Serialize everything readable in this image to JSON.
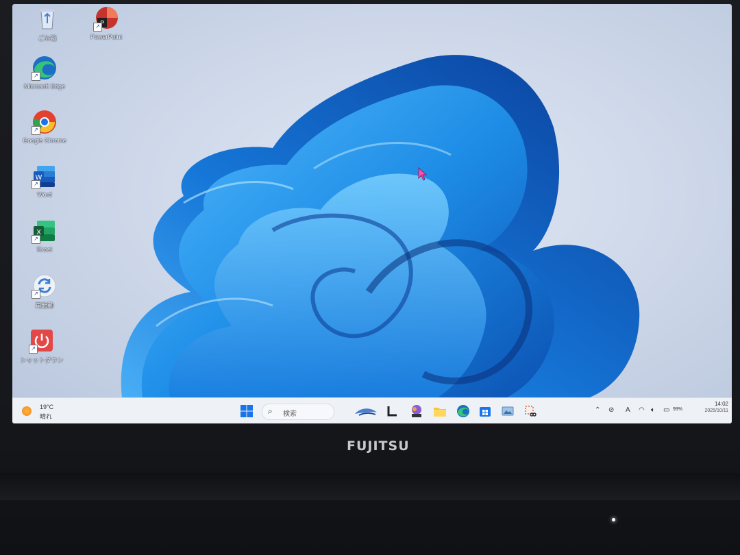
{
  "desktop": {
    "icons": [
      {
        "name": "recycle-bin-icon",
        "label": "ごみ箱"
      },
      {
        "name": "powerpoint-icon",
        "label": "PowerPoint"
      },
      {
        "name": "edge-icon",
        "label": "Microsoft Edge"
      },
      {
        "name": "chrome-icon",
        "label": "Google Chrome"
      },
      {
        "name": "word-icon",
        "label": "Word"
      },
      {
        "name": "excel-icon",
        "label": "Excel"
      },
      {
        "name": "restart-icon",
        "label": "再起動"
      },
      {
        "name": "shutdown-icon",
        "label": "シャットダウン"
      }
    ]
  },
  "taskbar": {
    "weather": {
      "temp": "19°C",
      "condition": "晴れ"
    },
    "search_placeholder": "検索",
    "tray": {
      "ime": "A",
      "battery": "99%"
    },
    "clock": {
      "time": "14:02",
      "date": "2025/10/11"
    }
  },
  "laptop": {
    "brand": "FUJITSU"
  },
  "colors": {
    "accent": "#1a73e8",
    "taskbar": "#eef1f6",
    "bloom": "#1e8fe8"
  }
}
